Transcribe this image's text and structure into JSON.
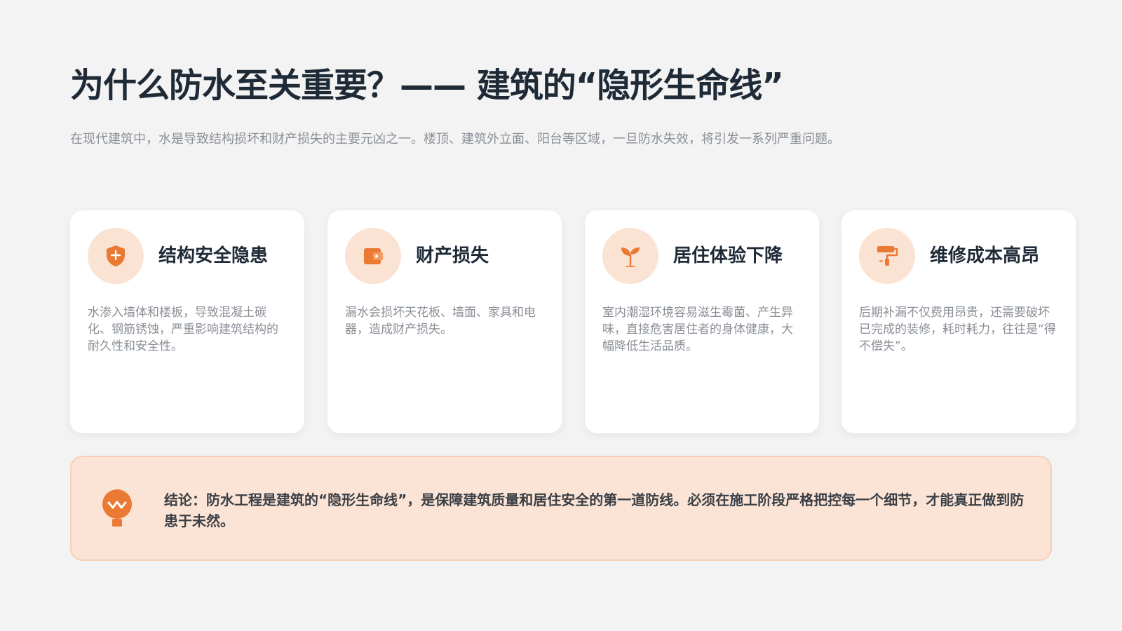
{
  "header": {
    "title": "为什么防水至关重要？—— 建筑的“隐形生命线”",
    "subtitle": "在现代建筑中，水是导致结构损坏和财产损失的主要元凶之一。楼顶、建筑外立面、阳台等区域，一旦防水失效，将引发一系列严重问题。"
  },
  "cards": [
    {
      "icon": "shield-plus-icon",
      "title": "结构安全隐患",
      "desc": "水渗入墙体和楼板，导致混凝土碳化、钢筋锈蚀，严重影响建筑结构的耐久性和安全性。"
    },
    {
      "icon": "wallet-icon",
      "title": "财产损失",
      "desc": "漏水会损坏天花板、墙面、家具和电器，造成财产损失。"
    },
    {
      "icon": "seedling-icon",
      "title": "居住体验下降",
      "desc": "室内潮湿环境容易滋生霉菌、产生异味，直接危害居住者的身体健康，大幅降低生活品质。"
    },
    {
      "icon": "paint-roller-icon",
      "title": "维修成本高昂",
      "desc": "后期补漏不仅费用昂贵，还需要破坏已完成的装修，耗时耗力，往往是“得不偿失”。"
    }
  ],
  "conclusion": {
    "icon": "lightbulb-icon",
    "text": "结论：防水工程是建筑的“隐形生命线”，是保障建筑质量和居住安全的第一道防线。必须在施工阶段严格把控每一个细节，才能真正做到防患于未然。"
  },
  "colors": {
    "accent": "#ea7a33",
    "accent_soft": "#fbe3d4",
    "title": "#1f2a37",
    "muted": "#8a8f96",
    "background": "#f3f3f3"
  }
}
